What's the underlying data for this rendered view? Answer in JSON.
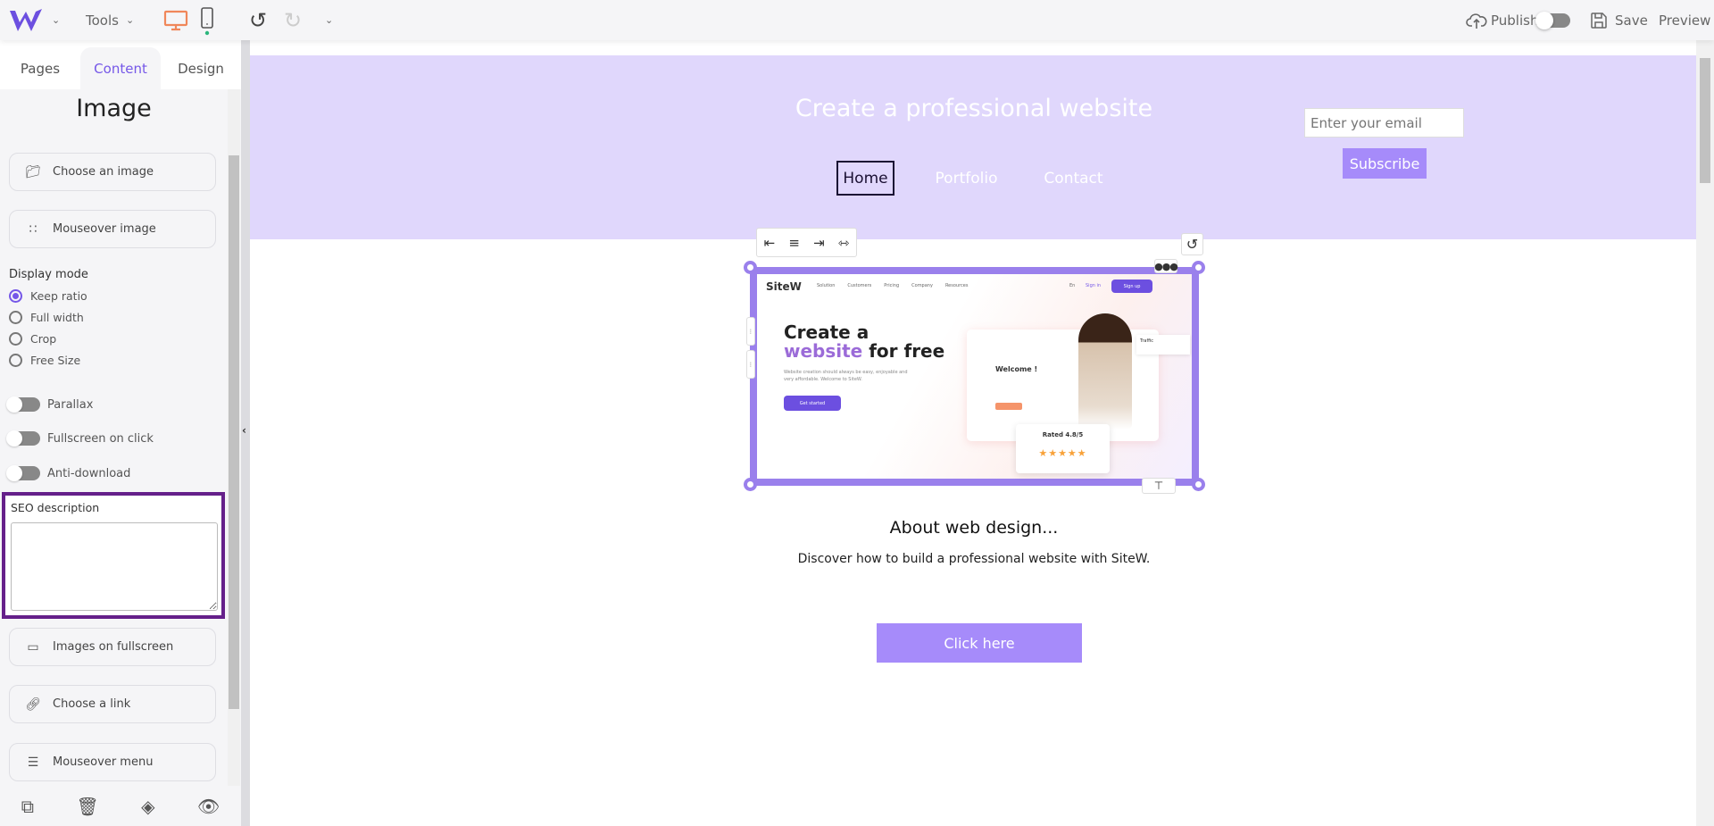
{
  "topbar": {
    "tools_label": "Tools",
    "publish_label": "Publish",
    "save_label": "Save",
    "preview_label": "Preview",
    "accent": "#f0875a",
    "logo_color": "#6c4fe0"
  },
  "sidebar": {
    "tabs": [
      {
        "label": "Pages"
      },
      {
        "label": "Content"
      },
      {
        "label": "Design"
      }
    ],
    "title": "Image",
    "choose_image": "Choose an image",
    "mouseover_image": "Mouseover image",
    "display_mode_label": "Display mode",
    "display_modes": [
      {
        "label": "Keep ratio",
        "selected": true
      },
      {
        "label": "Full width",
        "selected": false
      },
      {
        "label": "Crop",
        "selected": false
      },
      {
        "label": "Free Size",
        "selected": false
      }
    ],
    "toggles": [
      {
        "label": "Parallax",
        "on": false
      },
      {
        "label": "Fullscreen on click",
        "on": false
      },
      {
        "label": "Anti-download",
        "on": false
      }
    ],
    "seo_label": "SEO description",
    "seo_value": "",
    "images_fullscreen": "Images on fullscreen",
    "choose_link": "Choose a link",
    "mouseover_menu": "Mouseover menu"
  },
  "page": {
    "header_title": "Create a professional website",
    "nav": [
      "Home",
      "Portfolio",
      "Contact"
    ],
    "email_placeholder": "Enter your email",
    "subscribe_label": "Subscribe",
    "heading": "About web design...",
    "subtitle": "Discover how to build a professional website with SiteW.",
    "cta_label": "Click here",
    "header_bg": "#e0d7fc",
    "button_color": "#a68bfa"
  },
  "image_preview": {
    "logo": "SiteW",
    "menu": [
      "Solution",
      "Customers",
      "Pricing",
      "Company",
      "Resources"
    ],
    "lang": "En",
    "signin": "Sign in",
    "signup": "Sign up",
    "hero_line1": "Create a",
    "hero_word": "website",
    "hero_rest": "for free",
    "hero_text": "Website creation should always be easy, enjoyable and very affordable. Welcome to SiteW.",
    "get_started": "Get started",
    "welcome": "Welcome !",
    "traffic": "Traffic",
    "rating": "Rated 4.8/5",
    "stars": 5
  }
}
